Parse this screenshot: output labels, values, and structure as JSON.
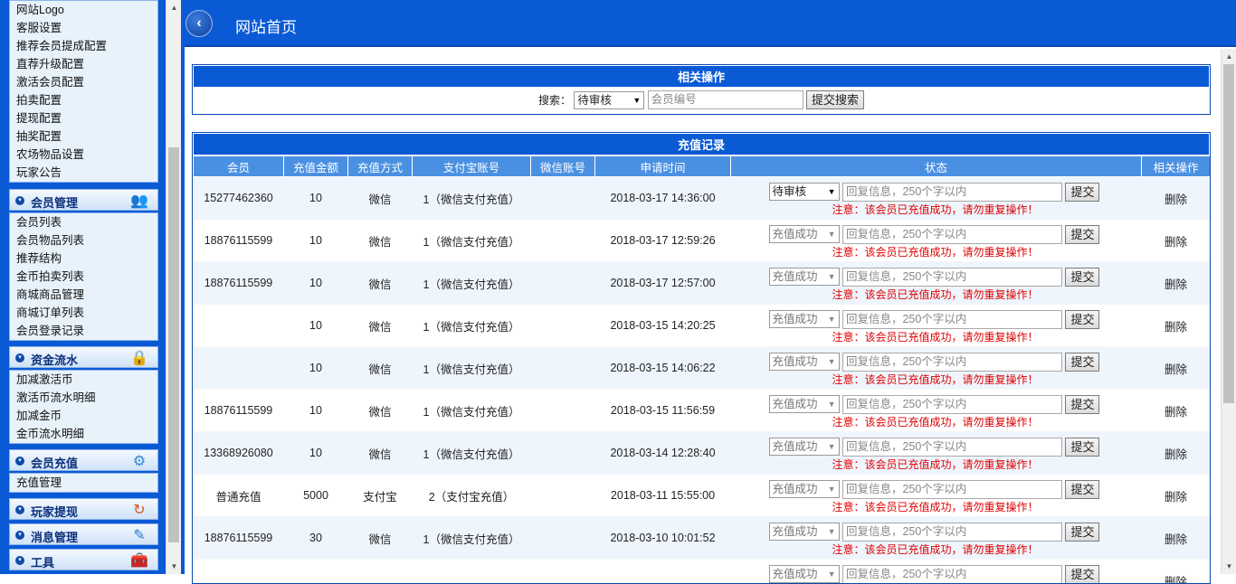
{
  "sidebar": {
    "top_items": [
      "网站Logo",
      "客服设置",
      "推荐会员提成配置",
      "直荐升级配置",
      "激活会员配置",
      "拍卖配置",
      "提现配置",
      "抽奖配置",
      "农场物品设置",
      "玩家公告"
    ],
    "sections": [
      {
        "title": "会员管理",
        "icon": "users-icon",
        "items": [
          "会员列表",
          "会员物品列表",
          "推荐结构",
          "金币拍卖列表",
          "商城商品管理",
          "商城订单列表",
          "会员登录记录"
        ]
      },
      {
        "title": "资金流水",
        "icon": "lock-icon",
        "items": [
          "加减激活币",
          "激活币流水明细",
          "加减金币",
          "金币流水明细"
        ]
      },
      {
        "title": "会员充值",
        "icon": "gears-icon",
        "items": [
          "充值管理"
        ]
      },
      {
        "title": "玩家提现",
        "icon": "refresh-icon",
        "items": []
      },
      {
        "title": "消息管理",
        "icon": "edit-icon",
        "items": []
      },
      {
        "title": "工具",
        "icon": "toolbox-icon",
        "items": []
      }
    ]
  },
  "header": {
    "title": "网站首页",
    "back_icon": "chevron-left-icon"
  },
  "ops_panel": {
    "title": "相关操作",
    "search_label": "搜索：",
    "status_value": "待审核",
    "member_placeholder": "会员编号",
    "submit_label": "提交搜索"
  },
  "records": {
    "title": "充值记录",
    "columns": [
      "会员",
      "充值金额",
      "充值方式",
      "支付宝账号",
      "微信账号",
      "申请时间",
      "状态",
      "相关操作"
    ],
    "reply_placeholder": "回复信息，250个字以内",
    "submit_label": "提交",
    "warning": "注意：该会员已充值成功，请勿重复操作！",
    "delete_label": "删除",
    "rows": [
      {
        "member": "15277462360",
        "amount": "10",
        "method": "微信",
        "alipay": "1（微信支付充值）",
        "wechat": "",
        "time": "2018-03-17 14:36:00",
        "status": "待审核"
      },
      {
        "member": "18876115599",
        "amount": "10",
        "method": "微信",
        "alipay": "1（微信支付充值）",
        "wechat": "",
        "time": "2018-03-17 12:59:26",
        "status": "充值成功"
      },
      {
        "member": "18876115599",
        "amount": "10",
        "method": "微信",
        "alipay": "1（微信支付充值）",
        "wechat": "",
        "time": "2018-03-17 12:57:00",
        "status": "充值成功"
      },
      {
        "member": "",
        "amount": "10",
        "method": "微信",
        "alipay": "1（微信支付充值）",
        "wechat": "",
        "time": "2018-03-15 14:20:25",
        "status": "充值成功"
      },
      {
        "member": "",
        "amount": "10",
        "method": "微信",
        "alipay": "1（微信支付充值）",
        "wechat": "",
        "time": "2018-03-15 14:06:22",
        "status": "充值成功"
      },
      {
        "member": "18876115599",
        "amount": "10",
        "method": "微信",
        "alipay": "1（微信支付充值）",
        "wechat": "",
        "time": "2018-03-15 11:56:59",
        "status": "充值成功"
      },
      {
        "member": "13368926080",
        "amount": "10",
        "method": "微信",
        "alipay": "1（微信支付充值）",
        "wechat": "",
        "time": "2018-03-14 12:28:40",
        "status": "充值成功"
      },
      {
        "member": "普通充值",
        "amount": "5000",
        "method": "支付宝",
        "alipay": "2（支付宝充值）",
        "wechat": "",
        "time": "2018-03-11 15:55:00",
        "status": "充值成功"
      },
      {
        "member": "18876115599",
        "amount": "30",
        "method": "微信",
        "alipay": "1（微信支付充值）",
        "wechat": "",
        "time": "2018-03-10 10:01:52",
        "status": "充值成功"
      },
      {
        "member": "",
        "amount": "",
        "method": "",
        "alipay": "",
        "wechat": "",
        "time": "",
        "status": "充值成功"
      }
    ]
  },
  "colors": {
    "primary": "#0a5ad6",
    "header_th": "#4a90e2",
    "warning": "#e00000",
    "row_alt": "#eef5fd"
  }
}
